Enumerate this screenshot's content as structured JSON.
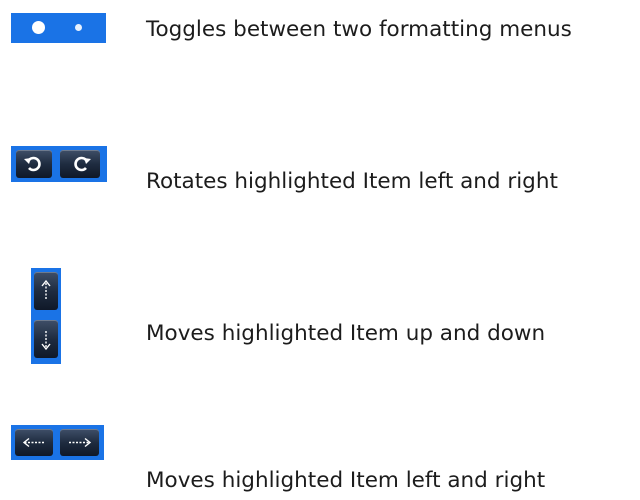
{
  "rows": [
    {
      "icon": "page-toggle-dots-icon",
      "label": "Toggles between two formatting menus"
    },
    {
      "icon": "rotate-buttons-icon",
      "label": "Rotates highlighted Item left and right"
    },
    {
      "icon": "up-down-buttons-icon",
      "label": "Moves highlighted Item up and down"
    },
    {
      "icon": "left-right-buttons-icon",
      "label": "Moves highlighted Item left and right"
    }
  ],
  "colors": {
    "panel_blue": "#1a73e6",
    "button_dark": "#1f2c40",
    "text": "#1c1c1c"
  }
}
